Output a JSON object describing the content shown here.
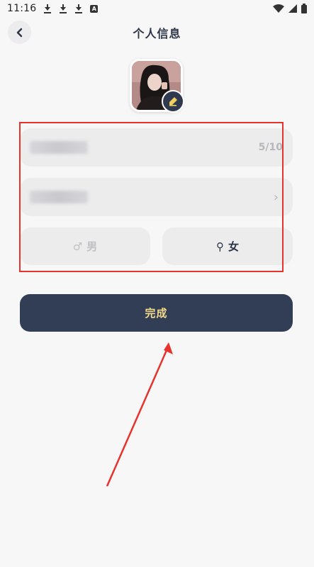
{
  "status_bar": {
    "time": "11:16",
    "left_icons": [
      "download-icon",
      "download-icon",
      "download-icon",
      "a-box-icon"
    ],
    "right_icons": [
      "wifi-icon",
      "signal-icon",
      "battery-icon"
    ]
  },
  "header": {
    "title": "个人信息",
    "back_icon": "chevron-left-icon"
  },
  "avatar": {
    "edit_icon": "pencil-icon"
  },
  "form": {
    "nickname_counter": "5/10",
    "birthday_chevron": "›",
    "gender": {
      "male_symbol": "♂",
      "male_label": "男",
      "female_symbol": "⚲",
      "female_label": "女"
    }
  },
  "actions": {
    "done_label": "完成"
  },
  "annotation": {
    "highlight_color": "#e8322c"
  },
  "colors": {
    "primary": "#323e55",
    "primary_text": "#f4d98a",
    "field_bg": "#ececed"
  }
}
